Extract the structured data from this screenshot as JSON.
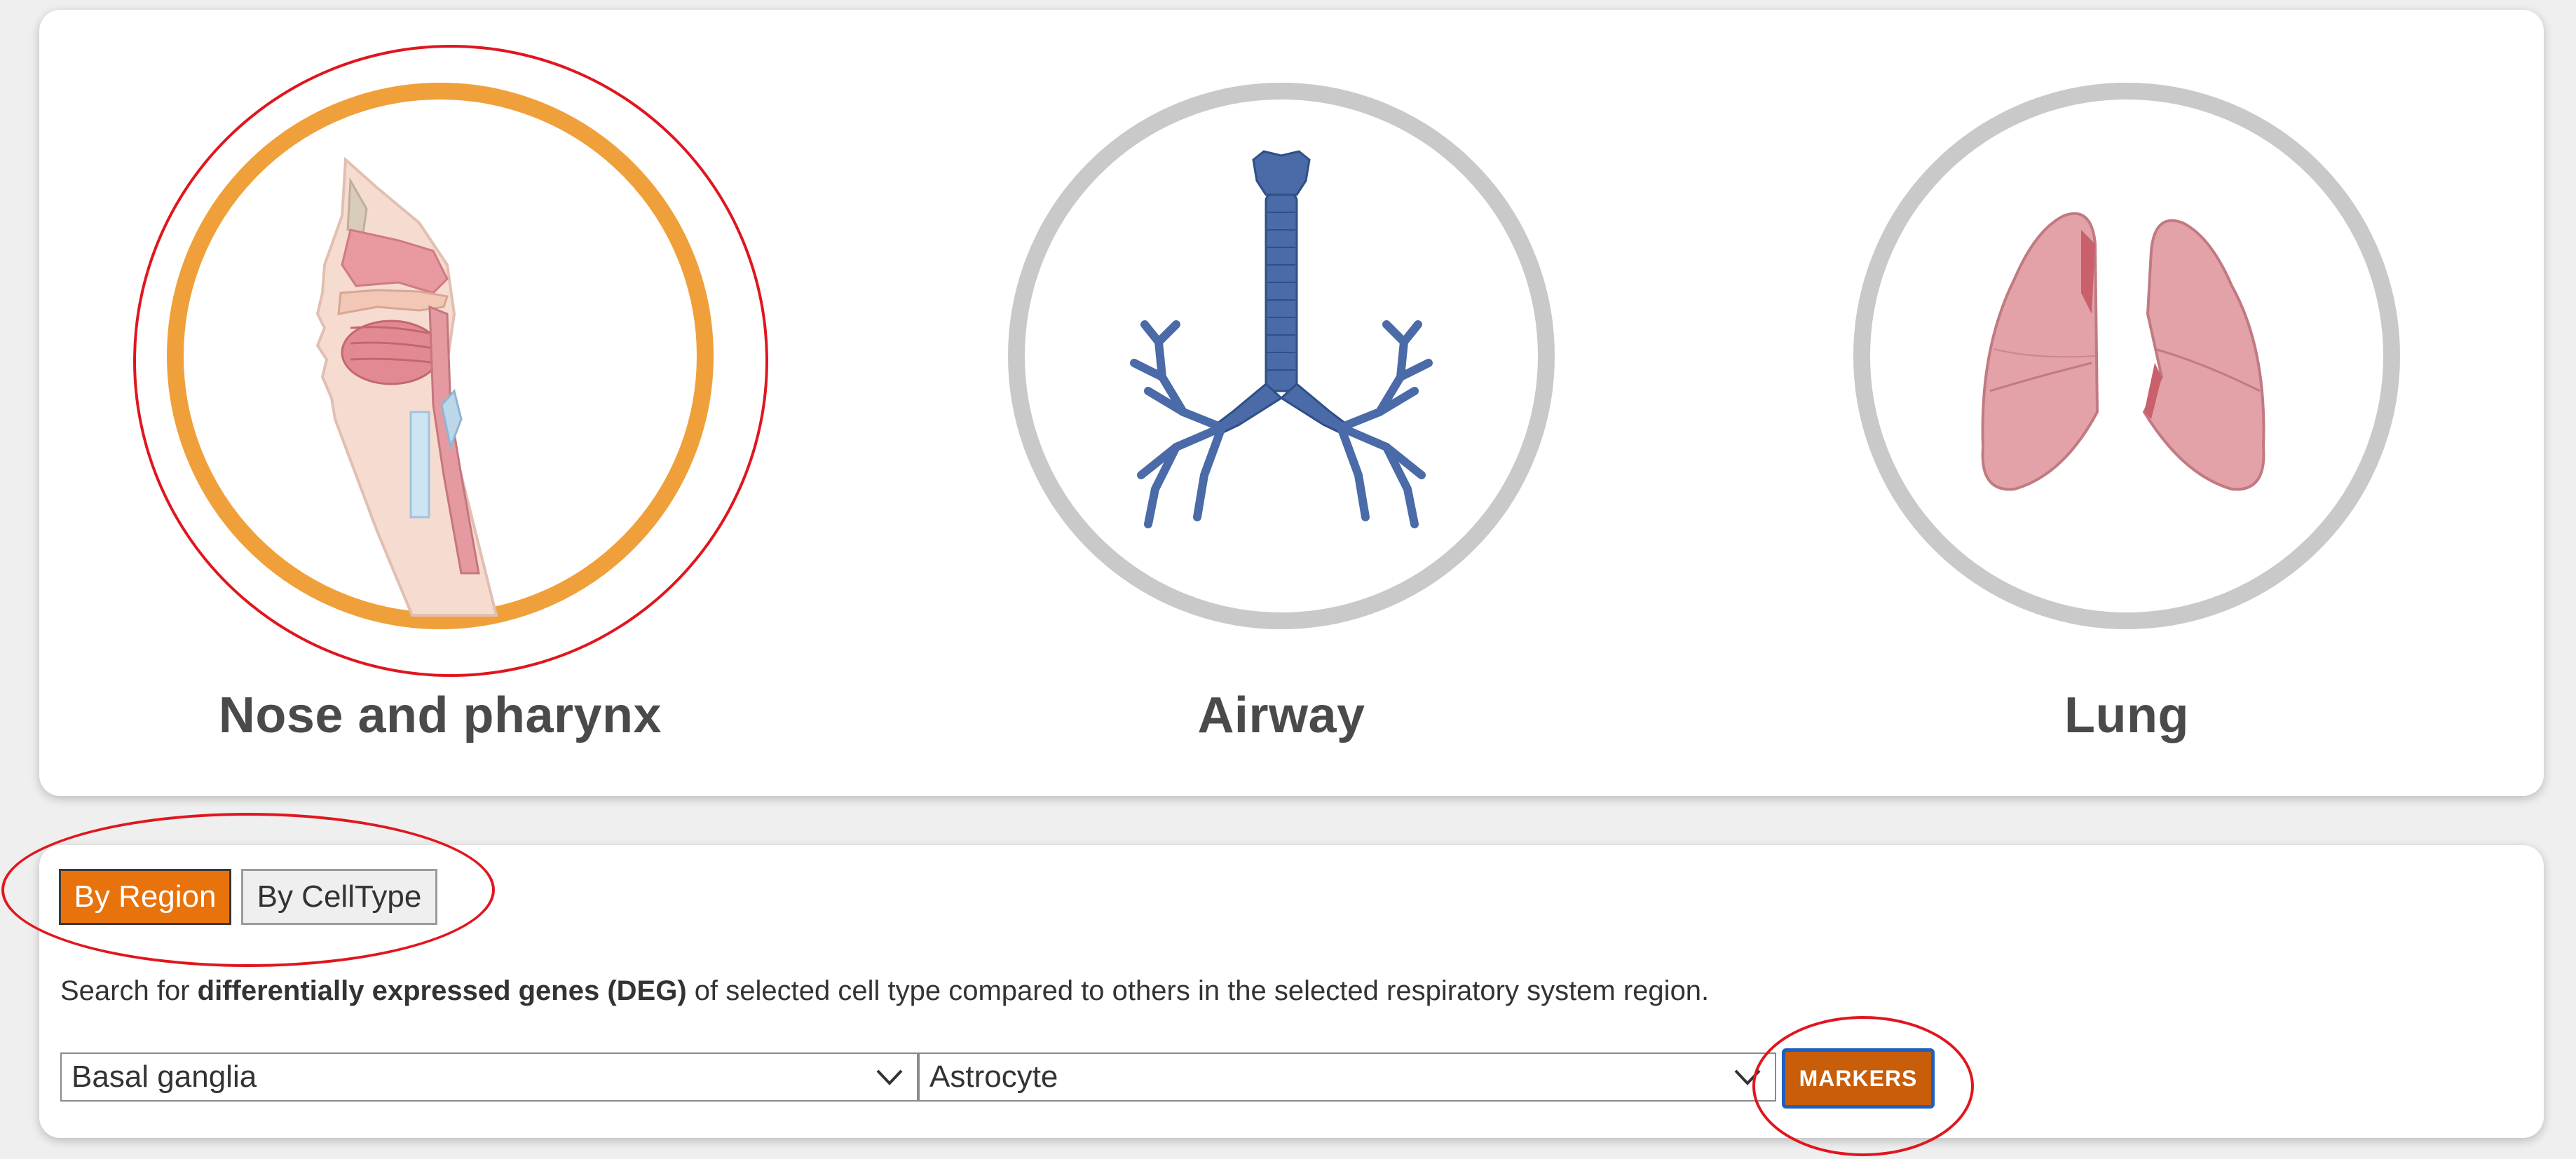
{
  "organs": [
    {
      "label": "Nose and pharynx",
      "selected": true
    },
    {
      "label": "Airway",
      "selected": false
    },
    {
      "label": "Lung",
      "selected": false
    }
  ],
  "toggle": {
    "by_region_label": "By Region",
    "by_celltype_label": "By CellType",
    "active": "By Region"
  },
  "search": {
    "description_prefix": "Search for ",
    "description_bold": "differentially expressed genes (DEG)",
    "description_suffix": " of selected cell type compared to others in the selected respiratory system region.",
    "region_value": "Basal ganglia",
    "celltype_value": "Astrocyte",
    "markers_label": "MARKERS"
  },
  "colors": {
    "accent_orange": "#e8730c",
    "selected_ring": "#f0a03a",
    "unselected_ring": "#c9c9c9",
    "markers_button": "#c85d0a",
    "annotation_red": "#e0161e",
    "airway_blue": "#4a6aa8",
    "lung_pink": "#e3a2a8"
  }
}
